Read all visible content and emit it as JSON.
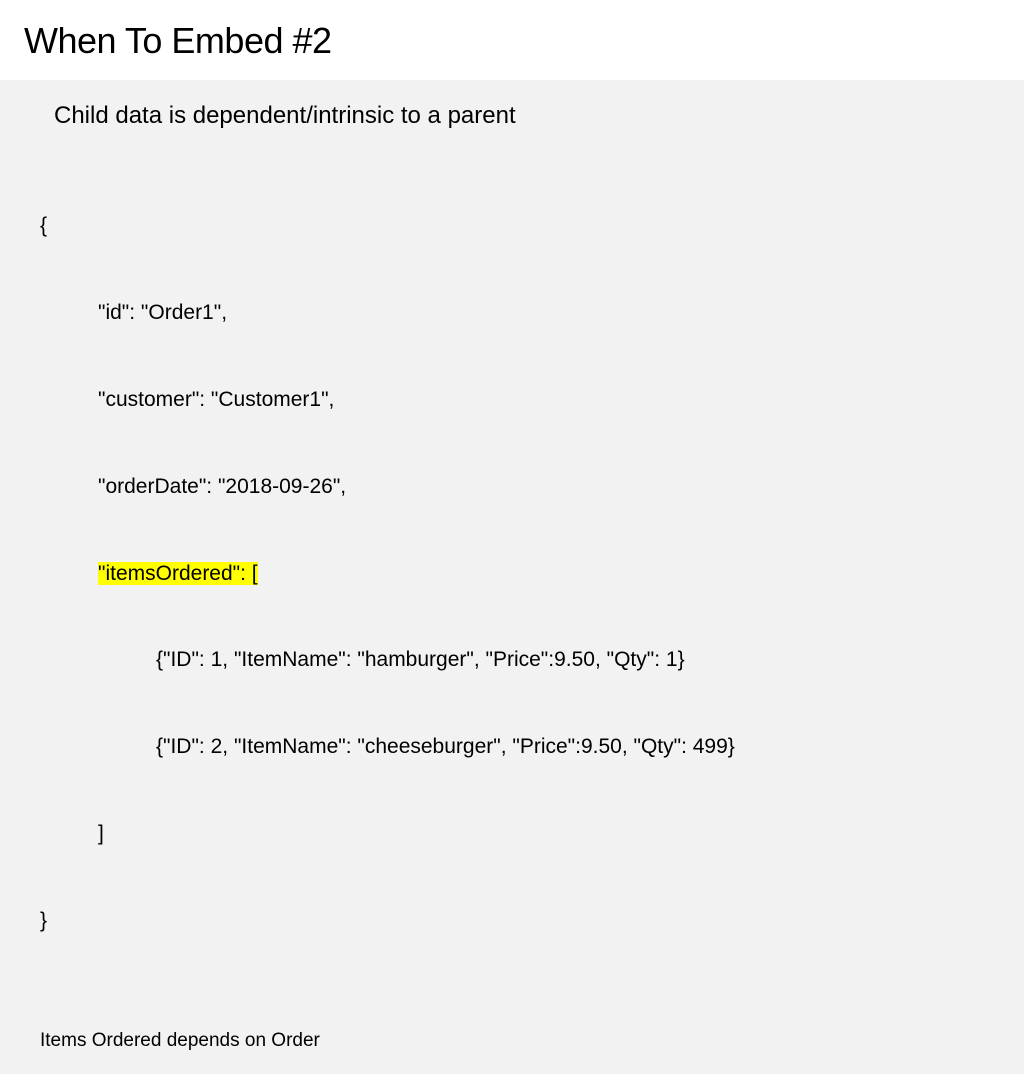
{
  "slide": {
    "title": "When To Embed #2",
    "subtitle": "Child data is dependent/intrinsic to a parent",
    "footer": "Items Ordered depends on Order"
  },
  "code": {
    "open": "{",
    "line1": "\"id\": \"Order1\",",
    "line2": "\"customer\": \"Customer1\",",
    "line3": "\"orderDate\": \"2018-09-26\",",
    "line4_hl": "\"itemsOrdered\": [",
    "line5": "{\"ID\": 1, \"ItemName\": \"hamburger\", \"Price\":9.50, \"Qty\": 1}",
    "line6": "{\"ID\": 2, \"ItemName\": \"cheeseburger\", \"Price\":9.50, \"Qty\": 499}",
    "line7": "]",
    "close": "}"
  }
}
